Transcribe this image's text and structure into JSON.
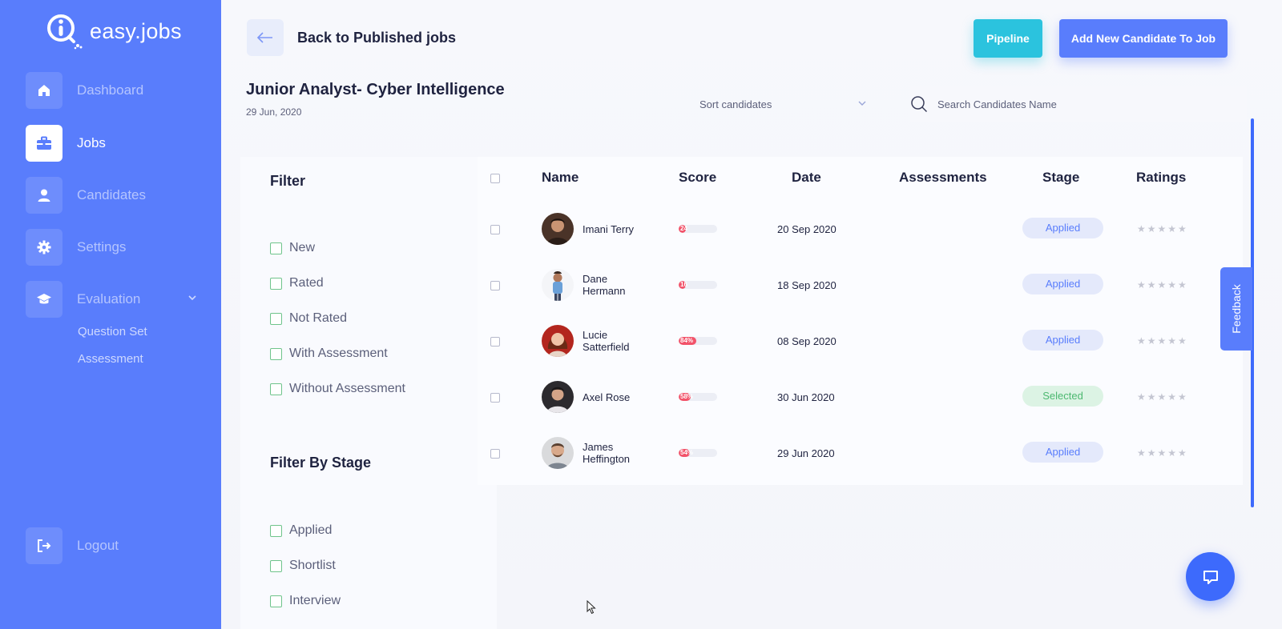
{
  "app": {
    "logo_text": "easy.jobs"
  },
  "sidebar": {
    "items": [
      {
        "label": "Dashboard",
        "icon": "home-icon",
        "active": false
      },
      {
        "label": "Jobs",
        "icon": "briefcase-icon",
        "active": true
      },
      {
        "label": "Candidates",
        "icon": "user-icon",
        "active": false
      },
      {
        "label": "Settings",
        "icon": "gear-icon",
        "active": false
      },
      {
        "label": "Evaluation",
        "icon": "graduation-cap-icon",
        "active": false
      }
    ],
    "evaluation_sub": [
      "Question Set",
      "Assessment"
    ],
    "logout": "Logout"
  },
  "header": {
    "back_label": "Back to Published jobs",
    "pipeline_label": "Pipeline",
    "add_candidate_label": "Add New Candidate To Job"
  },
  "job": {
    "title": "Junior Analyst- Cyber Intelligence",
    "date": "29 Jun, 2020"
  },
  "toolbar": {
    "sort_placeholder": "Sort candidates",
    "search_placeholder": "Search Candidates Name"
  },
  "filter": {
    "heading": "Filter",
    "options": [
      "New",
      "Rated",
      "Not Rated",
      "With Assessment",
      "Without Assessment"
    ],
    "stage_heading": "Filter By Stage",
    "stage_options": [
      "Applied",
      "Shortlist",
      "Interview"
    ]
  },
  "table": {
    "columns": [
      "Name",
      "Score",
      "Date",
      "Assessments",
      "Stage",
      "Ratings"
    ],
    "rows": [
      {
        "name_line1": "Imani Terry",
        "name_line2": "",
        "score_label": "24",
        "score_pct": 24,
        "date": "20 Sep 2020",
        "stage": "Applied",
        "stars": "★★★★★"
      },
      {
        "name_line1": "Dane",
        "name_line2": "Hermann",
        "score_label": "16",
        "score_pct": 16,
        "date": "18 Sep 2020",
        "stage": "Applied",
        "stars": "★★★★★"
      },
      {
        "name_line1": "Lucie",
        "name_line2": "Satterfield",
        "score_label": "84%",
        "score_pct": 84,
        "date": "08 Sep 2020",
        "stage": "Applied",
        "stars": "★★★★★"
      },
      {
        "name_line1": "Axel Rose",
        "name_line2": "",
        "score_label": "58%",
        "score_pct": 58,
        "date": "30 Jun 2020",
        "stage": "Selected",
        "stars": "★★★★★"
      },
      {
        "name_line1": "James",
        "name_line2": "Heffington",
        "score_label": "54%",
        "score_pct": 54,
        "date": "29 Jun 2020",
        "stage": "Applied",
        "stars": "★★★★★"
      }
    ]
  },
  "feedback_label": "Feedback",
  "colors": {
    "primary": "#597dfc",
    "pipeline": "#2bc3de",
    "score": "#f2536a",
    "selected": "#4cb870"
  }
}
